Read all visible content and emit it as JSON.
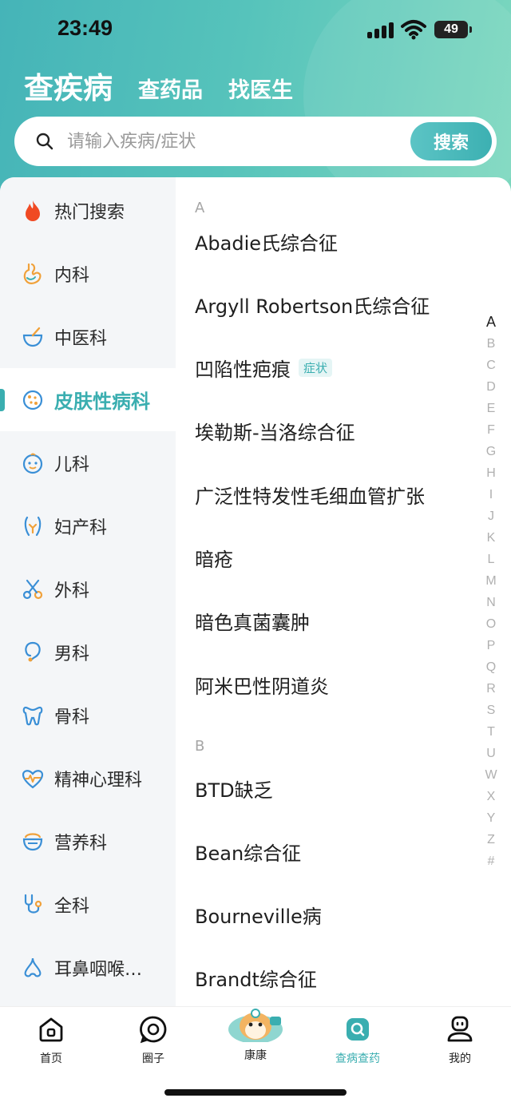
{
  "status_bar": {
    "time": "23:49",
    "battery": "49"
  },
  "header": {
    "tabs": [
      {
        "label": "查疾病",
        "active": true
      },
      {
        "label": "查药品",
        "active": false
      },
      {
        "label": "找医生",
        "active": false
      }
    ]
  },
  "search": {
    "placeholder": "请输入疾病/症状",
    "value": "",
    "button_label": "搜索"
  },
  "sidebar": {
    "items": [
      {
        "label": "热门搜索",
        "icon": "flame-icon"
      },
      {
        "label": "内科",
        "icon": "stomach-icon"
      },
      {
        "label": "中医科",
        "icon": "mortar-icon"
      },
      {
        "label": "皮肤性病科",
        "icon": "skin-icon",
        "active": true
      },
      {
        "label": "儿科",
        "icon": "baby-face-icon"
      },
      {
        "label": "妇产科",
        "icon": "uterus-icon"
      },
      {
        "label": "外科",
        "icon": "scissors-icon"
      },
      {
        "label": "男科",
        "icon": "male-icon"
      },
      {
        "label": "骨科",
        "icon": "bone-icon"
      },
      {
        "label": "精神心理科",
        "icon": "heart-pulse-icon"
      },
      {
        "label": "营养科",
        "icon": "bowl-icon"
      },
      {
        "label": "全科",
        "icon": "stethoscope-icon"
      },
      {
        "label": "耳鼻咽喉…",
        "icon": "nose-icon"
      }
    ]
  },
  "disease_list": {
    "sections": [
      {
        "letter": "A",
        "items": [
          {
            "name": "Abadie氏综合征"
          },
          {
            "name": "Argyll Robertson氏综合征"
          },
          {
            "name": "凹陷性疤痕",
            "tag": "症状"
          },
          {
            "name": "埃勒斯-当洛综合征"
          },
          {
            "name": "广泛性特发性毛细血管扩张"
          },
          {
            "name": "暗疮"
          },
          {
            "name": "暗色真菌囊肿"
          },
          {
            "name": "阿米巴性阴道炎"
          }
        ]
      },
      {
        "letter": "B",
        "items": [
          {
            "name": "BTD缺乏"
          },
          {
            "name": "Bean综合征"
          },
          {
            "name": "Bourneville病"
          },
          {
            "name": "Brandt综合征"
          }
        ]
      }
    ]
  },
  "alpha_index": [
    "A",
    "B",
    "C",
    "D",
    "E",
    "F",
    "G",
    "H",
    "I",
    "J",
    "K",
    "L",
    "M",
    "N",
    "O",
    "P",
    "Q",
    "R",
    "S",
    "T",
    "U",
    "W",
    "X",
    "Y",
    "Z",
    "#"
  ],
  "alpha_index_active": "A",
  "tab_bar": {
    "items": [
      {
        "label": "首页",
        "icon": "home-icon"
      },
      {
        "label": "圈子",
        "icon": "chat-circle-icon"
      },
      {
        "label": "康康",
        "icon": "mascot-icon"
      },
      {
        "label": "查病查药",
        "icon": "search-medicine-icon",
        "active": true
      },
      {
        "label": "我的",
        "icon": "profile-icon"
      }
    ]
  },
  "colors": {
    "accent": "#3aaeb0",
    "header_start": "#45b4b8",
    "header_end": "#7dd8be"
  }
}
